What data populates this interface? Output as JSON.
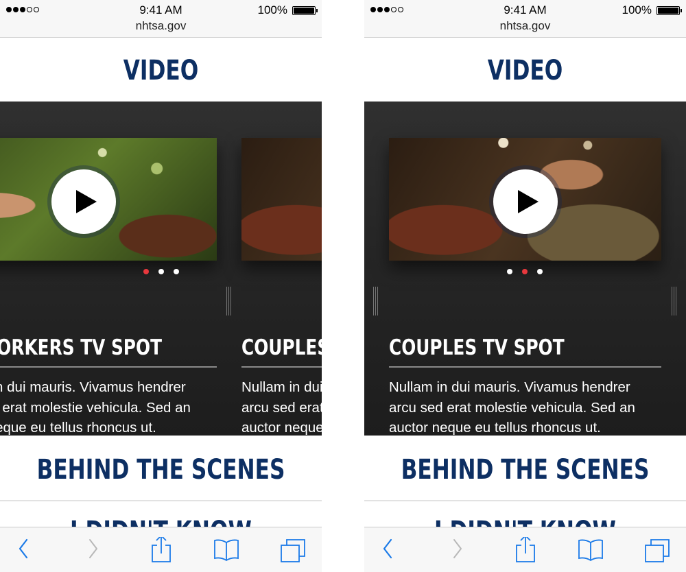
{
  "status_bar": {
    "time": "9:41 AM",
    "url": "nhtsa.gov",
    "battery": "100%"
  },
  "headings": {
    "video": "VIDEO",
    "behind_the_scenes": "BEHIND THE SCENES",
    "next_partial": "I DIDN'T KNOW THAT"
  },
  "left_screen": {
    "cards": [
      {
        "title": "CO-WORKERS TV SPOT",
        "text_lines": [
          "Nullam in dui mauris. Vivamus hendrer",
          "arcu sed erat molestie vehicula. Sed an",
          "auctor neque eu tellus rhoncus ut."
        ]
      },
      {
        "title": "COUPLES TV SPOT",
        "text_lines": [
          "Nullam in dui mauris. Vivamus hendrer",
          "arcu sed erat molestie vehicula. Sed an",
          "auctor neque eu tellus rhoncus ut."
        ]
      }
    ],
    "active_dot": 0
  },
  "right_screen": {
    "card": {
      "title": "COUPLES TV SPOT",
      "text_lines": [
        "Nullam in dui mauris. Vivamus hendrer",
        "arcu sed erat molestie vehicula. Sed an",
        "auctor neque eu tellus rhoncus ut."
      ]
    },
    "active_dot": 1
  },
  "toolbar_icons": [
    "back-icon",
    "forward-icon",
    "share-icon",
    "bookmarks-icon",
    "tabs-icon"
  ],
  "colors": {
    "heading_blue": "#0d2f63",
    "active_dot": "#e8383d",
    "ios_blue": "#1a7ae8",
    "panel_dark": "#262626"
  }
}
